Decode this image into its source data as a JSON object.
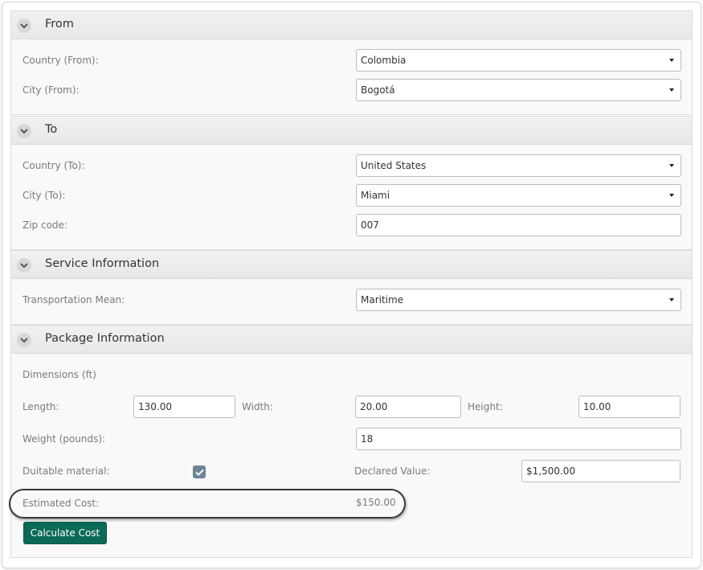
{
  "sections": {
    "from": {
      "title": "From",
      "country_label": "Country (From):",
      "country_value": "Colombia",
      "city_label": "City (From):",
      "city_value": "Bogotá"
    },
    "to": {
      "title": "To",
      "country_label": "Country (To):",
      "country_value": "United States",
      "city_label": "City (To):",
      "city_value": "Miami",
      "zip_label": "Zip code:",
      "zip_value": "007"
    },
    "service": {
      "title": "Service Information",
      "transport_label": "Transportation Mean:",
      "transport_value": "Maritime"
    },
    "package": {
      "title": "Package Information",
      "dimensions_label": "Dimensions (ft)",
      "length_label": "Length:",
      "length_value": "130.00",
      "width_label": "Width:",
      "width_value": "20.00",
      "height_label": "Height:",
      "height_value": "10.00",
      "weight_label": "Weight (pounds):",
      "weight_value": "18",
      "dutiable_label": "Duitable material:",
      "dutiable_checked": true,
      "declared_label": "Declared Value:",
      "declared_value": "$1,500.00",
      "estimated_label": "Estimated Cost:",
      "estimated_value": "$150.00",
      "calculate_label": "Calculate Cost"
    }
  },
  "icons": {
    "section_toggle": "chevron-down-icon",
    "checkbox": "checkmark-icon",
    "select": "caret-down-icon"
  },
  "colors": {
    "button_bg": "#0b6a56",
    "checkbox_bg": "#6f8593"
  }
}
